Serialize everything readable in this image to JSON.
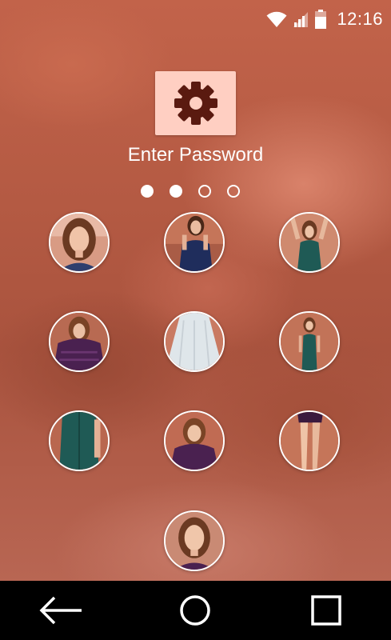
{
  "status_bar": {
    "time": "12:16",
    "icons": [
      "wifi-icon",
      "signal-icon",
      "battery-icon"
    ]
  },
  "lock": {
    "title": "Enter Password",
    "settings_icon": "gear-icon",
    "pin_length": 4,
    "pin_entered": 2,
    "keys": [
      {
        "name": "key-photo-1",
        "desc": "portrait-face"
      },
      {
        "name": "key-photo-2",
        "desc": "navy-top"
      },
      {
        "name": "key-photo-3",
        "desc": "teal-dress-arms-up"
      },
      {
        "name": "key-photo-4",
        "desc": "purple-lace-top"
      },
      {
        "name": "key-photo-5",
        "desc": "white-skirt"
      },
      {
        "name": "key-photo-6",
        "desc": "teal-dress-standing"
      },
      {
        "name": "key-photo-7",
        "desc": "teal-dress-closeup"
      },
      {
        "name": "key-photo-8",
        "desc": "purple-top-smiling"
      },
      {
        "name": "key-photo-9",
        "desc": "legs"
      },
      {
        "name": "key-photo-0",
        "desc": "portrait-close"
      }
    ]
  },
  "colors": {
    "settings_bg": "#ffcfc2",
    "gear": "#5a1a10",
    "nav_bg": "#000000"
  },
  "nav": {
    "icons": [
      "back-icon",
      "home-icon",
      "recents-icon"
    ]
  }
}
